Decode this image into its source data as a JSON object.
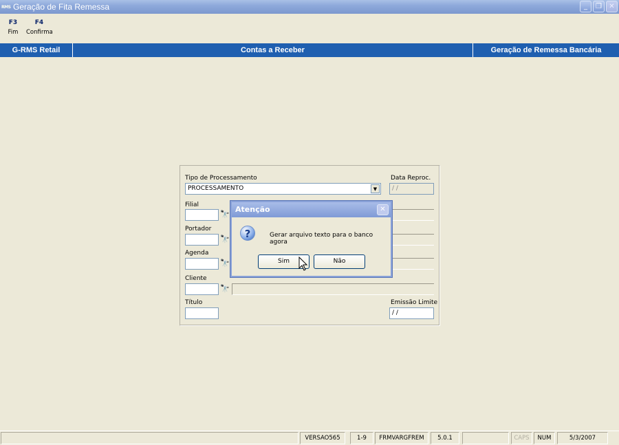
{
  "window": {
    "app_icon_text": "RMS",
    "title": "Geração de Fita Remessa",
    "buttons": {
      "minimize": "_",
      "restore": "❐",
      "close": "✕"
    }
  },
  "toolbar": [
    {
      "key": "F3",
      "label": "Fim"
    },
    {
      "key": "F4",
      "label": "Confirma"
    }
  ],
  "header": {
    "left": "G-RMS Retail",
    "center": "Contas a Receber",
    "right": "Geração de Remessa Bancária"
  },
  "form": {
    "tipo_label": "Tipo de Processamento",
    "tipo_value": "PROCESSAMENTO",
    "data_reproc_label": "Data Reproc.",
    "data_reproc_value": "/ /",
    "filial_label": "Filial",
    "portador_label": "Portador",
    "agenda_label": "Agenda",
    "cliente_label": "Cliente",
    "titulo_label": "Título",
    "emissao_label": "Emissão Limite",
    "emissao_value": "/ /",
    "icons": {
      "lookup": "binoculars-icon",
      "dropdown": "chevron-down-icon"
    }
  },
  "dialog": {
    "title": "Atenção",
    "message": "Gerar arquivo texto para o banco agora",
    "yes_label": "Sim",
    "no_label": "Não",
    "icon": "question-icon"
  },
  "statusbar": {
    "version": "VERSAO565",
    "page": "1-9",
    "form_name": "FRMVARGFREM",
    "app_version": "5.0.1",
    "caps": "CAPS",
    "num": "NUM",
    "date": "5/3/2007"
  },
  "colors": {
    "title_bar": "#8ea9db",
    "header_band": "#1f5fb0",
    "background": "#ece9d8",
    "toolbar_key": "#0a246a"
  }
}
